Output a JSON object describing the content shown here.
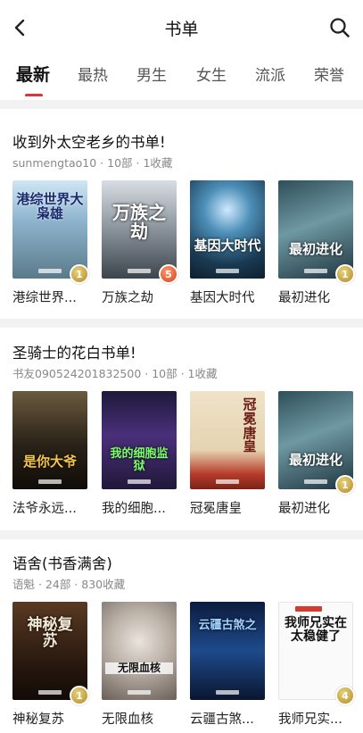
{
  "header": {
    "title": "书单"
  },
  "tabs": [
    "最新",
    "最热",
    "男生",
    "女生",
    "流派",
    "荣誉"
  ],
  "sections": [
    {
      "title": "收到外太空老乡的书单!",
      "meta": "sunmengtao10 · 10部 · 1收藏",
      "books": [
        {
          "name": "港综世界...",
          "cover_text": "港综世界大枭雄",
          "badge": "1",
          "badge_color": "gold"
        },
        {
          "name": "万族之劫",
          "cover_text": "万族之劫",
          "badge": "5",
          "badge_color": "red"
        },
        {
          "name": "基因大时代",
          "cover_text": "基因大时代",
          "badge": "",
          "badge_color": ""
        },
        {
          "name": "最初进化",
          "cover_text": "最初进化",
          "badge": "1",
          "badge_color": "gold"
        }
      ]
    },
    {
      "title": "圣骑士的花白书单!",
      "meta": "书友090524201832500 · 10部 · 1收藏",
      "books": [
        {
          "name": "法爷永远...",
          "cover_text": "是你大爷",
          "badge": "",
          "badge_color": ""
        },
        {
          "name": "我的细胞...",
          "cover_text": "我的细胞监狱",
          "badge": "",
          "badge_color": ""
        },
        {
          "name": "冠冕唐皇",
          "cover_text": "冠冕唐皇",
          "badge": "",
          "badge_color": ""
        },
        {
          "name": "最初进化",
          "cover_text": "最初进化",
          "badge": "1",
          "badge_color": "gold"
        }
      ]
    },
    {
      "title": "语舍(书香满舍)",
      "meta": "语魁 · 24部 · 830收藏",
      "books": [
        {
          "name": "神秘复苏",
          "cover_text": "神秘复苏",
          "badge": "1",
          "badge_color": "gold"
        },
        {
          "name": "无限血核",
          "cover_text": "无限血核",
          "badge": "",
          "badge_color": ""
        },
        {
          "name": "云疆古煞...",
          "cover_text": "云疆古煞之",
          "badge": "",
          "badge_color": ""
        },
        {
          "name": "我师兄实...",
          "cover_text": "我师兄实在太稳健了",
          "badge": "4",
          "badge_color": "gold"
        }
      ]
    }
  ],
  "colors": {
    "accent": "#e0323c",
    "separator": "#f2f2f2"
  },
  "icons": {
    "back": "chevron-left-icon",
    "search": "search-icon"
  }
}
